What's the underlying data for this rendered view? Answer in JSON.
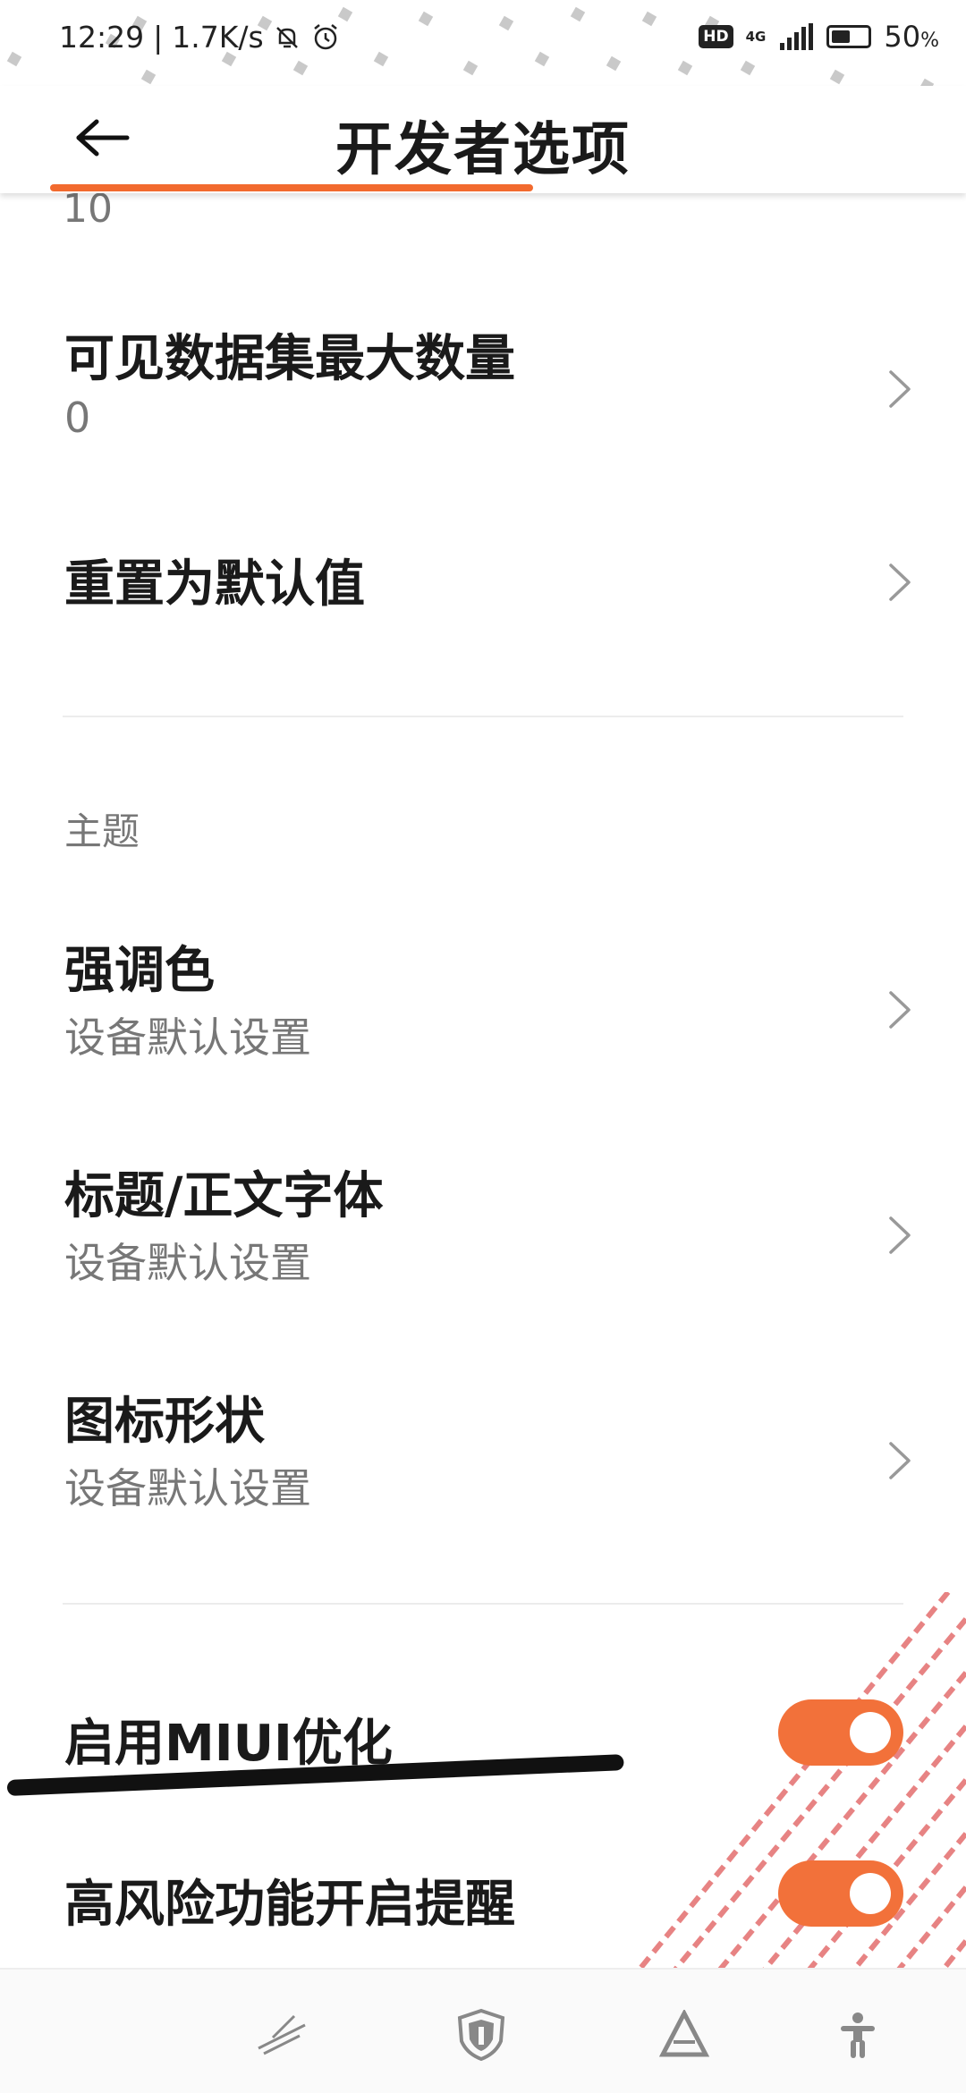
{
  "status_bar": {
    "time": "12:29",
    "speed": "1.7K/s",
    "hd": "HD",
    "network": "4G",
    "battery": "50",
    "battery_unit": "%"
  },
  "header": {
    "title": "开发者选项"
  },
  "list": {
    "cut_off_value": "10",
    "max_datasets": {
      "title": "可见数据集最大数量",
      "value": "0"
    },
    "reset_default": {
      "title": "重置为默认值"
    },
    "theme_section": "主题",
    "accent_color": {
      "title": "强调色",
      "value": "设备默认设置"
    },
    "headline_font": {
      "title": "标题/正文字体",
      "value": "设备默认设置"
    },
    "icon_shape": {
      "title": "图标形状",
      "value": "设备默认设置"
    },
    "miui_optimization": {
      "title": "启用MIUI优化",
      "enabled": true
    },
    "high_risk_reminder": {
      "title": "高风险功能开启提醒",
      "enabled": true
    }
  },
  "colors": {
    "accent": "#f26a2e",
    "toggle_on": "#f2713a",
    "secondary_text": "#777777"
  },
  "bottom_nav": {
    "icons": [
      "streak-icon",
      "shield-icon",
      "triangle-icon",
      "accessibility-icon"
    ]
  }
}
